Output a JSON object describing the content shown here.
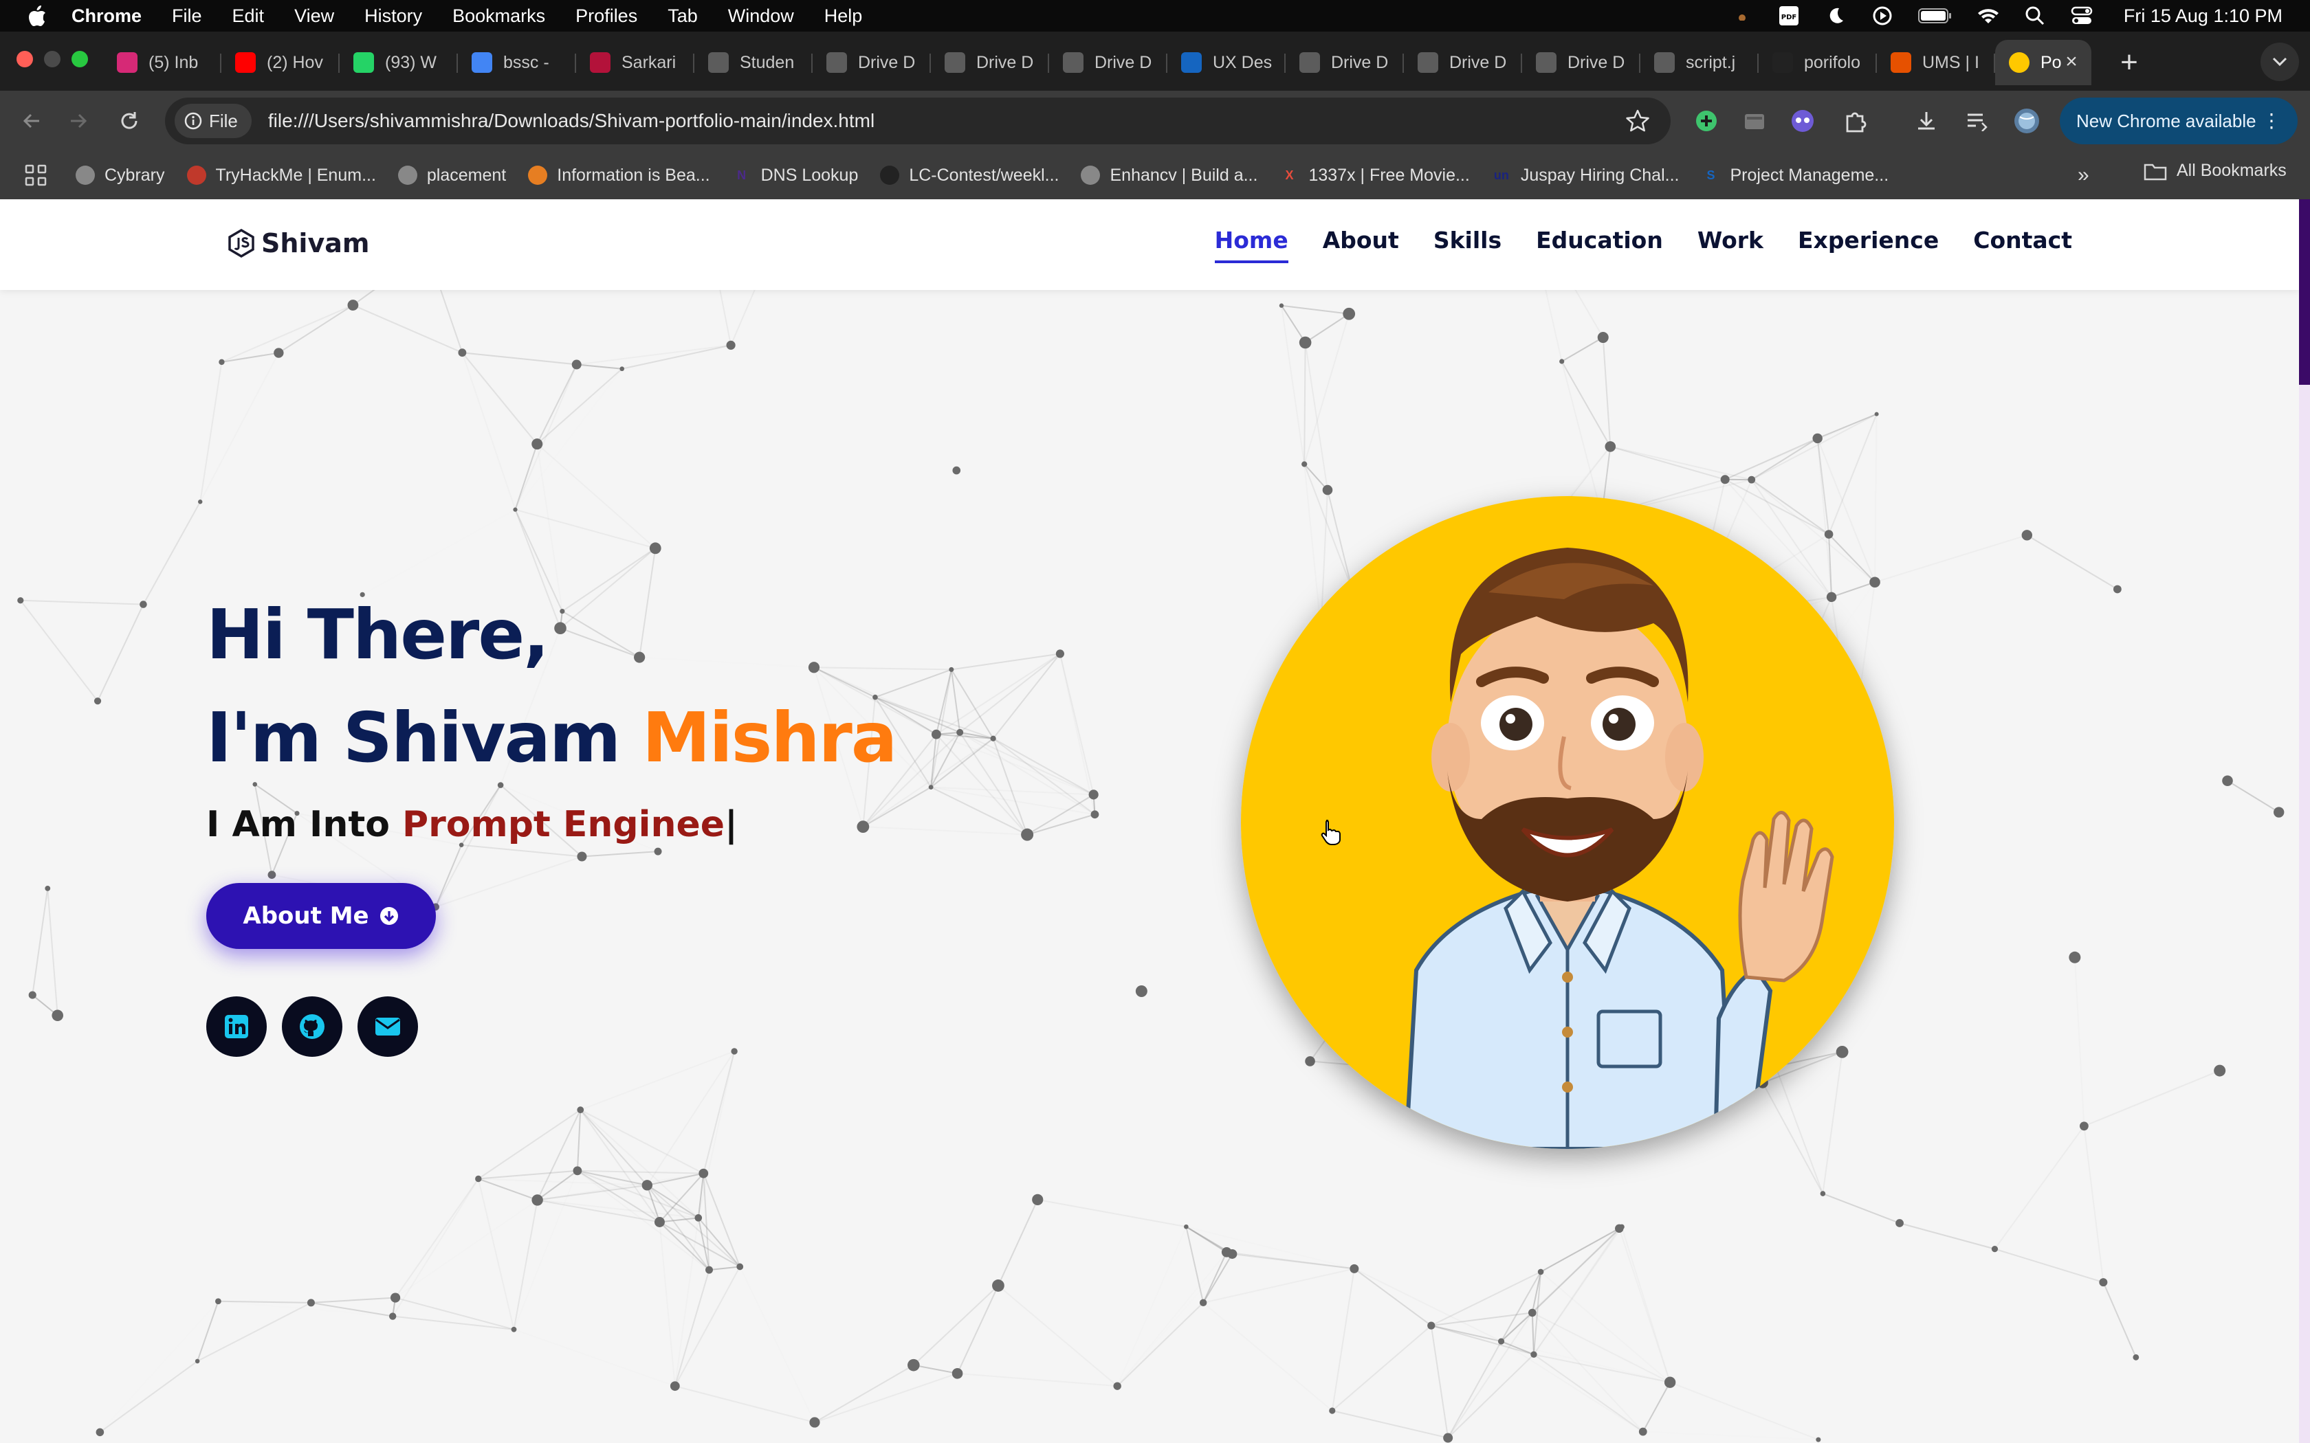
{
  "menubar": {
    "app": "Chrome",
    "items": [
      "File",
      "Edit",
      "View",
      "History",
      "Bookmarks",
      "Profiles",
      "Tab",
      "Window",
      "Help"
    ],
    "clock": "Fri 15 Aug  1:10 PM",
    "status_icons": [
      "pdf-icon",
      "moon-icon",
      "play-icon",
      "battery-icon",
      "wifi-icon",
      "search-icon",
      "control-center-icon"
    ]
  },
  "tabs": [
    {
      "label": "(5) Inb",
      "icon": "instagram-icon",
      "color": "#d62976"
    },
    {
      "label": "(2) Hov",
      "icon": "youtube-icon",
      "color": "#ff0000"
    },
    {
      "label": "(93) W",
      "icon": "whatsapp-icon",
      "color": "#25d366"
    },
    {
      "label": "bssc -",
      "icon": "google-icon",
      "color": "#4285f4"
    },
    {
      "label": "Sarkari",
      "icon": "sarkari-icon",
      "color": "#b3123a"
    },
    {
      "label": "Studen",
      "icon": "globe-icon",
      "color": "#5c5c5c"
    },
    {
      "label": "Drive D",
      "icon": "globe-icon",
      "color": "#5c5c5c"
    },
    {
      "label": "Drive D",
      "icon": "globe-icon",
      "color": "#5c5c5c"
    },
    {
      "label": "Drive D",
      "icon": "globe-icon",
      "color": "#5c5c5c"
    },
    {
      "label": "UX Des",
      "icon": "ux-icon",
      "color": "#1565c0"
    },
    {
      "label": "Drive D",
      "icon": "globe-icon",
      "color": "#5c5c5c"
    },
    {
      "label": "Drive D",
      "icon": "globe-icon",
      "color": "#5c5c5c"
    },
    {
      "label": "Drive D",
      "icon": "globe-icon",
      "color": "#5c5c5c"
    },
    {
      "label": "script.j",
      "icon": "globe-icon",
      "color": "#5c5c5c"
    },
    {
      "label": "porifolo",
      "icon": "github-icon",
      "color": "#222"
    },
    {
      "label": "UMS | I",
      "icon": "ums-icon",
      "color": "#e65100"
    }
  ],
  "active_tab": {
    "label": "Po",
    "icon": "portfolio-avatar-icon"
  },
  "toolbar": {
    "site_chip": "File",
    "url": "file:///Users/shivammishra/Downloads/Shivam-portfolio-main/index.html",
    "new_chrome": "New Chrome available"
  },
  "bookmarks": [
    {
      "label": "Cybrary",
      "color": "#888"
    },
    {
      "label": "TryHackMe | Enum...",
      "color": "#c0392b"
    },
    {
      "label": "placement",
      "color": "#888"
    },
    {
      "label": "Information is Bea...",
      "color": "#e67e22"
    },
    {
      "label": "DNS Lookup",
      "color": "#4b2a8a",
      "glyph": "N"
    },
    {
      "label": "LC-Contest/weekl...",
      "color": "#222"
    },
    {
      "label": "Enhancv | Build a...",
      "color": "#888"
    },
    {
      "label": "1337x | Free Movie...",
      "color": "#e74c3c",
      "glyph": "X"
    },
    {
      "label": "Juspay Hiring Chal...",
      "color": "#1a237e",
      "glyph": "un"
    },
    {
      "label": "Project Manageme...",
      "color": "#1565c0",
      "glyph": "S"
    }
  ],
  "all_bookmarks": "All Bookmarks",
  "site": {
    "logo": "Shivam",
    "nav": [
      "Home",
      "About",
      "Skills",
      "Education",
      "Work",
      "Experience",
      "Contact"
    ],
    "active_nav": "Home",
    "hero": {
      "greeting": "Hi There,",
      "name_prefix": "I'm Shivam ",
      "name_accent": "Mishra",
      "typed_prefix": "I Am Into ",
      "typed_text": "Prompt Enginee",
      "caret": "|",
      "button": "About Me"
    },
    "socials": [
      "linkedin-icon",
      "github-icon",
      "envelope-icon"
    ]
  },
  "colors": {
    "navy": "#0b1e55",
    "accent_orange": "#ff7b0f",
    "typed_red": "#991a15",
    "button_purple": "#2d12b2",
    "nav_active": "#2b2bd6",
    "avatar_bg": "#ffc800",
    "social_icon": "#19c6ee"
  }
}
